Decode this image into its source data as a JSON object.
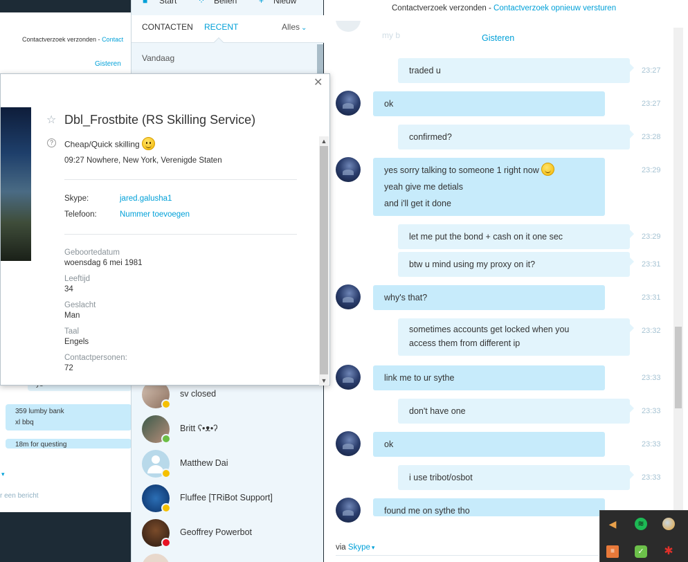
{
  "bg_window": {
    "request_text": "Contactverzoek verzonden - ",
    "request_link": "Contact",
    "yesterday": "Gisteren",
    "mini_messages": [
      {
        "text": "ye"
      },
      {
        "line1": "359 lumby bank",
        "line2": "xl bbq"
      },
      {
        "text": "18m for questing"
      }
    ],
    "send_placeholder": "r een bericht"
  },
  "contacts": {
    "topnav": [
      "Start",
      "Bellen",
      "Nieuw"
    ],
    "tab_contacts": "CONTACTEN",
    "tab_recent": "RECENT",
    "filter": "Alles",
    "section_today": "Vandaag",
    "rows": [
      {
        "name": "sv closed",
        "status": "away",
        "status_color": "#f5c000"
      },
      {
        "name": "Britt ʕ•ᴥ•ʔ",
        "status": "online",
        "status_color": "#6cbe45"
      },
      {
        "name": "Matthew Dai",
        "status": "away",
        "status_color": "#f5c000"
      },
      {
        "name": "Fluffee [TRiBot Support]",
        "status": "away",
        "status_color": "#f5c000"
      },
      {
        "name": "Geoffrey Powerbot",
        "status": "busy",
        "status_color": "#e81123"
      }
    ]
  },
  "profile": {
    "display_name": "Dbl_Frostbite (RS Skilling Service)",
    "mood": "Cheap/Quick skilling",
    "location": "09:27 Nowhere, New York, Verenigde Staten",
    "skype_label": "Skype:",
    "skype_value": "jared.galusha1",
    "phone_label": "Telefoon:",
    "phone_value": "Nummer toevoegen",
    "fields": [
      {
        "label": "Geboortedatum",
        "value": "woensdag 6 mei 1981"
      },
      {
        "label": "Leeftijd",
        "value": "34"
      },
      {
        "label": "Geslacht",
        "value": "Man"
      },
      {
        "label": "Taal",
        "value": "Engels"
      },
      {
        "label": "Contactpersonen:",
        "value": "72"
      }
    ]
  },
  "chat": {
    "header_text": "Contactverzoek verzonden - ",
    "header_link": "Contactverzoek opnieuw versturen",
    "ghost_text": "my b",
    "day_label": "Gisteren",
    "messages": [
      {
        "dir": "out",
        "lines": [
          "traded u"
        ],
        "time": "23:27"
      },
      {
        "dir": "in",
        "lines": [
          "ok"
        ],
        "time": "23:27"
      },
      {
        "dir": "out",
        "lines": [
          "confirmed?"
        ],
        "time": "23:28"
      },
      {
        "dir": "in",
        "lines": [
          "yes sorry talking to someone 1 right now",
          "yeah give me detials",
          "and i'll get it done"
        ],
        "time": "23:29"
      },
      {
        "dir": "out",
        "lines": [
          "let me put the bond + cash on it one sec"
        ],
        "time": "23:29"
      },
      {
        "dir": "out",
        "lines": [
          "btw u mind using my proxy on it?"
        ],
        "time": "23:31"
      },
      {
        "dir": "in",
        "lines": [
          "why's that?"
        ],
        "time": "23:31"
      },
      {
        "dir": "out",
        "lines": [
          "sometimes accounts get locked when you",
          "access them from different ip"
        ],
        "time": "23:32"
      },
      {
        "dir": "in",
        "lines": [
          "link me to ur sythe"
        ],
        "time": "23:33"
      },
      {
        "dir": "out",
        "lines": [
          "don't have one"
        ],
        "time": "23:33"
      },
      {
        "dir": "in",
        "lines": [
          "ok"
        ],
        "time": "23:33"
      },
      {
        "dir": "out",
        "lines": [
          "i use tribot/osbot"
        ],
        "time": "23:33"
      },
      {
        "dir": "in",
        "lines": [
          "found me on sythe tho"
        ],
        "time": ""
      }
    ],
    "via_label": "via",
    "via_link": "Skype"
  },
  "tray": {
    "icons": [
      "speaker-icon",
      "spotify-icon",
      "globe-icon",
      "app-orange-icon",
      "chat-green-icon",
      "app-red-icon"
    ]
  }
}
